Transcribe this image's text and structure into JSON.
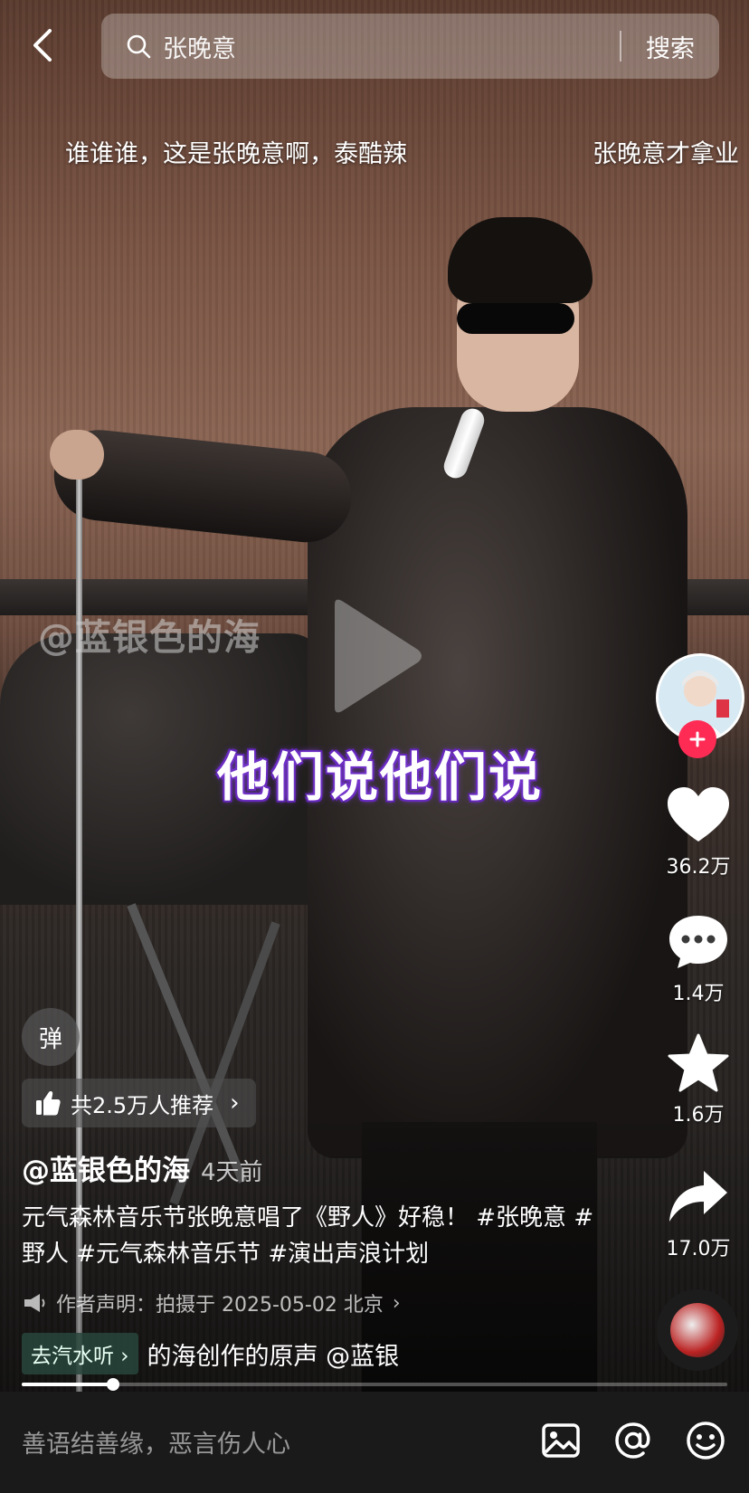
{
  "search": {
    "query": "张晚意",
    "button_label": "搜索"
  },
  "danmaku": [
    "谁谁谁，这是张晚意啊，泰酷辣",
    "张晚意才拿业"
  ],
  "video": {
    "watermark": "@蓝银色的海",
    "subtitle": "他们说他们说"
  },
  "actions": {
    "likes": "36.2万",
    "comments": "1.4万",
    "favorites": "1.6万",
    "shares": "17.0万"
  },
  "info": {
    "danmu_button": "弹",
    "recommend": "共2.5万人推荐",
    "author": "@蓝银色的海",
    "time_ago": "4天前",
    "description": "元气森林音乐节张晚意唱了《野人》好稳！ #张晚意 #野人 #元气森林音乐节 #演出声浪计划",
    "statement": "作者声明：拍摄于 2025-05-02 北京",
    "soda_tag": "去汽水听",
    "music": "的海创作的原声  @蓝银"
  },
  "progress": {
    "fraction": 0.13
  },
  "comment": {
    "placeholder": "善语结善缘，恶言伤人心"
  },
  "colors": {
    "accent": "#fe2c55",
    "subtitle_glow": "#7a3bd0"
  }
}
